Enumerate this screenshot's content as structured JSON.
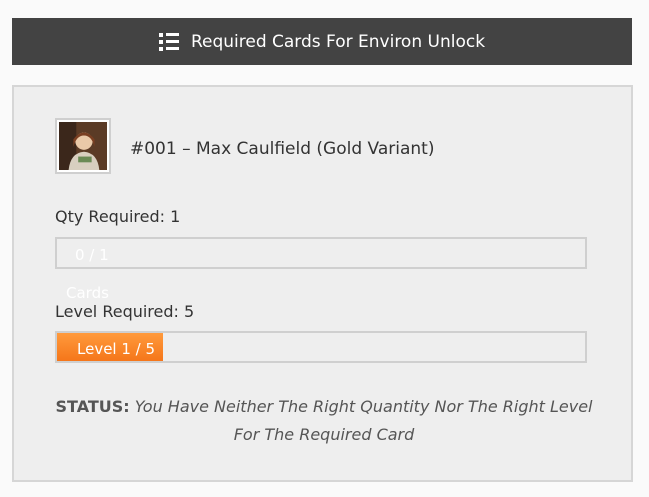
{
  "header": {
    "title": "Required Cards For Environ Unlock",
    "icon": "list-icon"
  },
  "card": {
    "name": "#001 – Max Caulfield (Gold Variant)",
    "thumbnail_icon": "card-portrait"
  },
  "quantity": {
    "label": "Qty Required: 1",
    "progress_text": "0 / 1",
    "progress_unit": "Cards",
    "current": 0,
    "required": 1
  },
  "level": {
    "label": "Level Required: 5",
    "progress_text": "Level 1 / 5",
    "current": 1,
    "required": 5,
    "fill_fraction": 0.2
  },
  "status": {
    "label": "STATUS:",
    "message": "You Have Neither The Right Quantity Nor The Right Level For The Required Card"
  },
  "colors": {
    "header_bg": "#434343",
    "accent_orange": "#f5761a",
    "panel_bg": "#eeeeee"
  }
}
